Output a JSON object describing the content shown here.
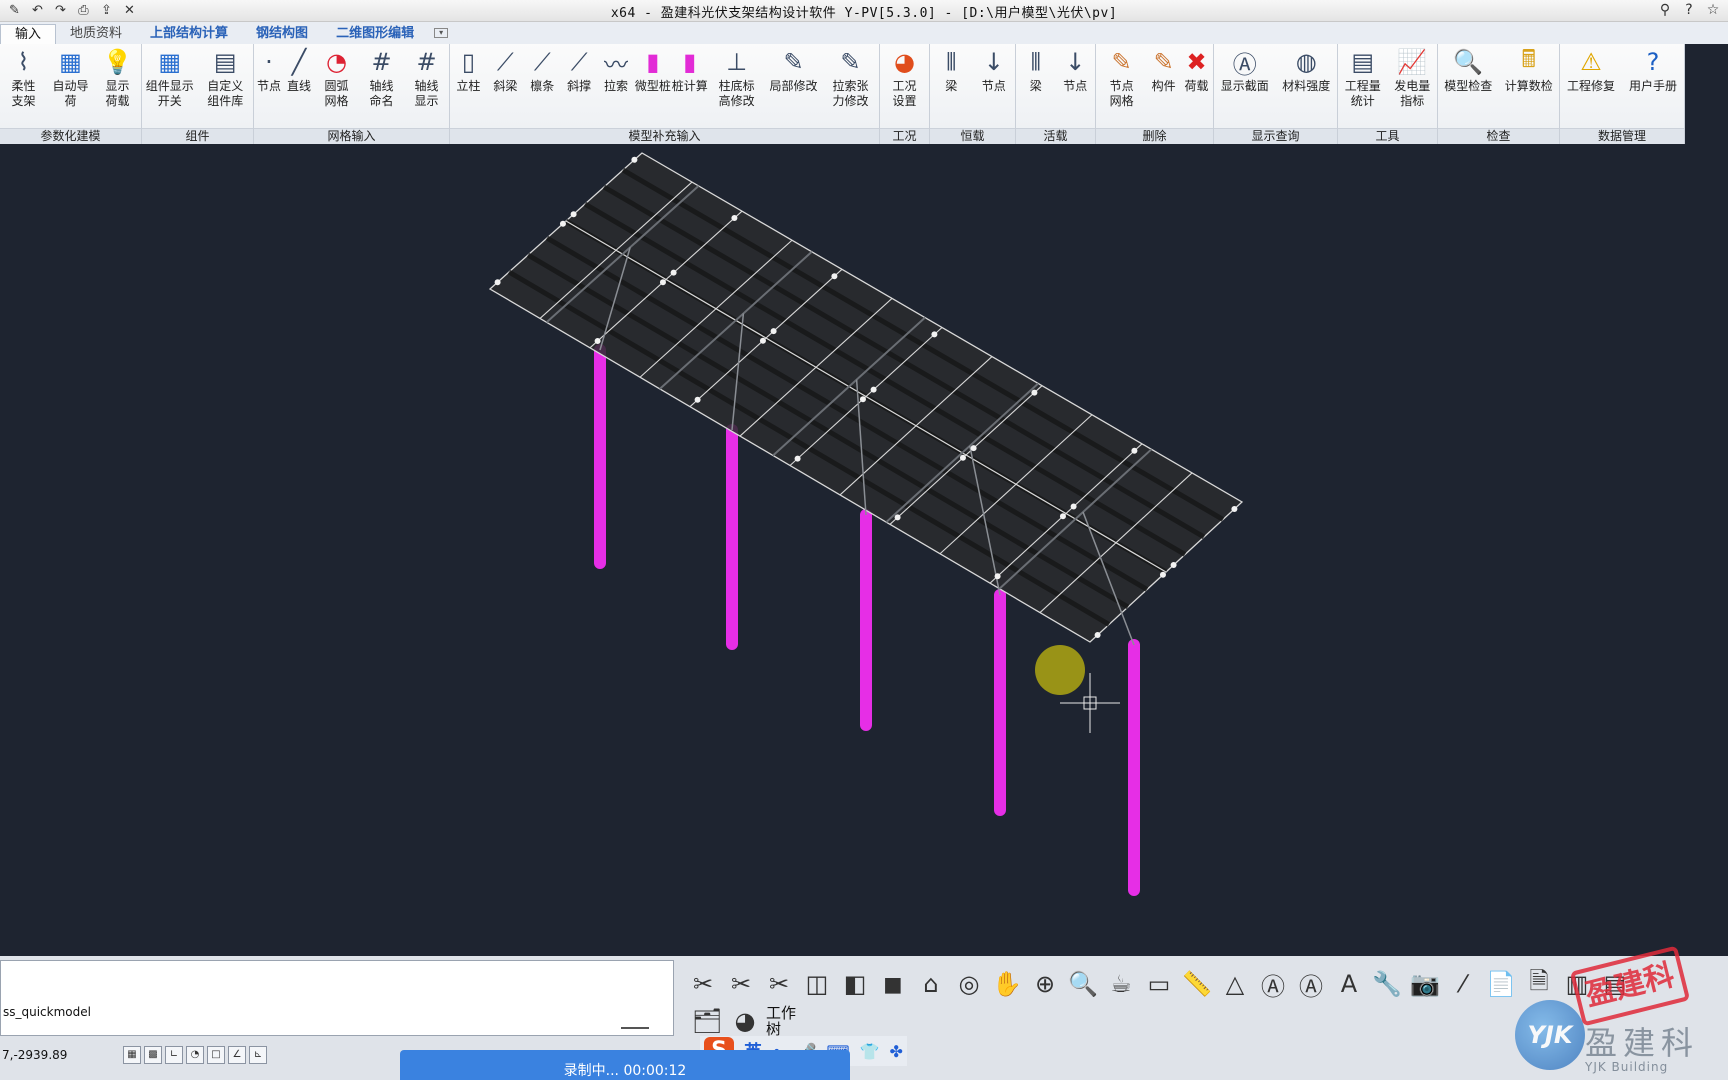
{
  "window": {
    "title": "x64 - 盈建科光伏支架结构设计软件 Y-PV[5.3.0] - [D:\\用户模型\\光伏\\pv]"
  },
  "tabs": [
    {
      "label": "输入",
      "active": true
    },
    {
      "label": "地质资料"
    },
    {
      "label": "上部结构计算"
    },
    {
      "label": "钢结构图"
    },
    {
      "label": "二维图形编辑"
    }
  ],
  "ribbon": {
    "groups": [
      {
        "name": "参数化建模",
        "buttons": [
          {
            "label": "柔性\n支架",
            "icon": "flexible-support-icon"
          },
          {
            "label": "自动导荷",
            "icon": "auto-load-icon"
          },
          {
            "label": "显示\n荷载",
            "icon": "bulb-icon"
          }
        ]
      },
      {
        "name": "组件",
        "buttons": [
          {
            "label": "组件显示\n开关",
            "icon": "panel-toggle-icon"
          },
          {
            "label": "自定义\n组件库",
            "icon": "custom-library-icon"
          }
        ]
      },
      {
        "name": "网格输入",
        "buttons": [
          {
            "label": "节点",
            "icon": "node-icon"
          },
          {
            "label": "直线",
            "icon": "line-icon"
          },
          {
            "label": "圆弧\n网格",
            "icon": "arc-grid-icon"
          },
          {
            "label": "轴线\n命名",
            "icon": "axis-name-icon"
          },
          {
            "label": "轴线\n显示",
            "icon": "axis-display-icon"
          }
        ]
      },
      {
        "name": "模型补充输入",
        "buttons": [
          {
            "label": "立柱",
            "icon": "column-icon"
          },
          {
            "label": "斜梁",
            "icon": "inclined-beam-icon"
          },
          {
            "label": "檩条",
            "icon": "purlin-icon"
          },
          {
            "label": "斜撑",
            "icon": "brace-icon"
          },
          {
            "label": "拉索",
            "icon": "cable-icon"
          },
          {
            "label": "微型桩",
            "icon": "micro-pile-icon"
          },
          {
            "label": "桩计算",
            "icon": "pile-calc-icon"
          },
          {
            "label": "柱底标\n高修改",
            "icon": "column-base-icon"
          },
          {
            "label": "局部修改",
            "icon": "local-edit-icon"
          },
          {
            "label": "拉索张\n力修改",
            "icon": "cable-tension-icon"
          }
        ]
      },
      {
        "name": "工况",
        "buttons": [
          {
            "label": "工况\n设置",
            "icon": "load-case-icon"
          }
        ]
      },
      {
        "name": "恒载",
        "buttons": [
          {
            "label": "梁",
            "icon": "dead-beam-icon"
          },
          {
            "label": "节点",
            "icon": "dead-node-icon"
          }
        ]
      },
      {
        "name": "活载",
        "buttons": [
          {
            "label": "梁",
            "icon": "live-beam-icon"
          },
          {
            "label": "节点",
            "icon": "live-node-icon"
          }
        ]
      },
      {
        "name": "删除",
        "buttons": [
          {
            "label": "节点\n网格",
            "icon": "delete-grid-icon"
          },
          {
            "label": "构件",
            "icon": "delete-member-icon"
          },
          {
            "label": "荷载",
            "icon": "delete-load-icon"
          }
        ]
      },
      {
        "name": "显示查询",
        "buttons": [
          {
            "label": "显示截面",
            "icon": "section-icon"
          },
          {
            "label": "材料强度",
            "icon": "material-icon"
          }
        ]
      },
      {
        "name": "工具",
        "buttons": [
          {
            "label": "工程量\n统计",
            "icon": "quantity-icon"
          },
          {
            "label": "发电量\n指标",
            "icon": "power-icon"
          }
        ]
      },
      {
        "name": "检查",
        "buttons": [
          {
            "label": "模型检查",
            "icon": "model-check-icon"
          },
          {
            "label": "计算数检",
            "icon": "calc-check-icon"
          }
        ]
      },
      {
        "name": "数据管理",
        "buttons": [
          {
            "label": "工程修复",
            "icon": "repair-icon"
          },
          {
            "label": "用户手册",
            "icon": "help-icon"
          }
        ]
      }
    ]
  },
  "command": {
    "last": "ss_quickmodel"
  },
  "status": {
    "coords": "7,-2939.89"
  },
  "worktree": {
    "label": "工作\n树"
  },
  "ime": {
    "lang": "英"
  },
  "recording": {
    "text": "录制中... 00:00:12"
  },
  "watermark": {
    "brand": "盈建科",
    "sub": "YJK Building",
    "stamp": "盈建科"
  },
  "colors": {
    "viewport_bg": "#1e2430",
    "column": "#e62ee6",
    "panel_line": "#d9d9d9",
    "cursor_dot": "#a09a16"
  }
}
